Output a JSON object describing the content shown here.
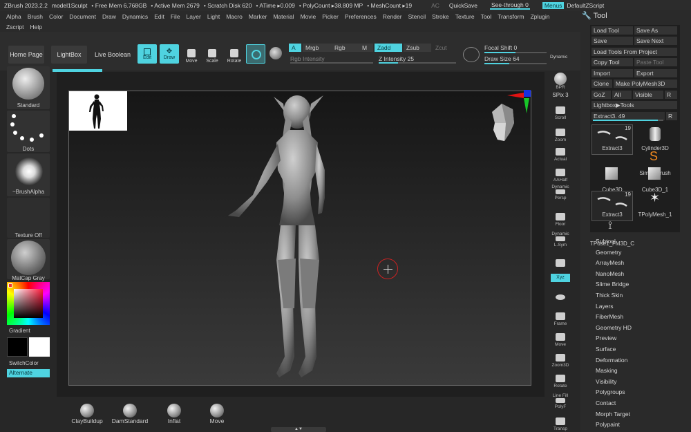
{
  "titlebar": {
    "app": "ZBrush 2023.2.2",
    "doc": "model1Sculpt",
    "free_mem": "• Free Mem 6.768GB",
    "active_mem": "• Active Mem 2679",
    "scratch": "• Scratch Disk 620",
    "atime": "• ATime ▸0.009",
    "polycount": "• PolyCount ▸38.809 MP",
    "meshcount": "• MeshCount ▸19",
    "ac": "AC",
    "quicksave": "QuickSave",
    "seethrough": "See-through",
    "seethrough_value": "0",
    "menus": "Menus",
    "script": "DefaultZScript"
  },
  "menu": {
    "row1": [
      "Alpha",
      "Brush",
      "Color",
      "Document",
      "Draw",
      "Dynamics",
      "Edit",
      "File",
      "Layer",
      "Light",
      "Macro",
      "Marker",
      "Material",
      "Movie",
      "Picker",
      "Preferences",
      "Render",
      "Stencil",
      "Stroke",
      "Texture",
      "Tool",
      "Transform",
      "Zplugin"
    ],
    "row2": [
      "Zscript",
      "Help"
    ]
  },
  "toolbar": {
    "home": "Home Page",
    "lightbox": "LightBox",
    "liveboolean": "Live Boolean",
    "edit": "Edit",
    "draw": "Draw",
    "move": "Move",
    "scale": "Scale",
    "rotate": "Rotate",
    "a": "A",
    "mrgb": "Mrgb",
    "rgb": "Rgb",
    "m": "M",
    "zadd": "Zadd",
    "zsub": "Zsub",
    "zcut": "Zcut",
    "rgb_intensity": "Rgb Intensity",
    "z_intensity": "Z Intensity",
    "z_intensity_value": "25",
    "focal_shift": "Focal Shift",
    "focal_value": "0",
    "draw_size": "Draw Size",
    "draw_size_value": "64",
    "dynamic": "Dynamic"
  },
  "left": {
    "brush": "Standard",
    "stroke": "Dots",
    "alpha": "~BrushAlpha",
    "texture": "Texture Off",
    "material": "MatCap Gray",
    "gradient": "Gradient",
    "switchcolor": "SwitchColor",
    "alternate": "Alternate"
  },
  "right_strip": {
    "bpr": "BPR",
    "spix": "SPix",
    "spix_value": "3",
    "scroll": "Scroll",
    "zoom": "Zoom",
    "actual": "Actual",
    "aahalf": "AAHalf",
    "dynamic": "Dynamic",
    "persp": "Persp",
    "floor": "Floor",
    "dynamic2": "Dynamic",
    "lsym": "L.Sym",
    "xyz": "Xyz",
    "frame": "Frame",
    "move": "Move",
    "zoom3d": "Zoom3D",
    "rotate": "Rotate",
    "linefill": "Line Fill",
    "polyf": "PolyF",
    "transp": "Transp"
  },
  "tool": {
    "title": "Tool",
    "buttons": {
      "load_tool": "Load Tool",
      "save_as": "Save As",
      "save": "Save",
      "save_next": "Save Next",
      "load_from_project": "Load Tools From Project",
      "copy_tool": "Copy Tool",
      "paste_tool": "Paste Tool",
      "import": "Import",
      "export": "Export",
      "clone": "Clone",
      "make_polymesh": "Make PolyMesh3D",
      "goz": "GoZ",
      "all": "All",
      "visible": "Visible",
      "r": "R",
      "lightbox_tools": "Lightbox▶Tools"
    },
    "extract_label": "Extract3.",
    "extract_value": "49",
    "r2": "R",
    "thumbs": [
      {
        "name": "Extract3",
        "count": "19"
      },
      {
        "name": "Cylinder3D",
        "count": ""
      },
      {
        "name": "SimpleBrush",
        "count": ""
      },
      {
        "name": "Cube3D",
        "count": ""
      },
      {
        "name": "Cube3D_1",
        "count": ""
      },
      {
        "name": "Extract3",
        "count": "19"
      },
      {
        "name": "TPolyMesh_1",
        "count": ""
      },
      {
        "name": "TPose1_FM3D_C",
        "count": ""
      }
    ],
    "subpalettes": [
      "Subtool",
      "Geometry",
      "ArrayMesh",
      "NanoMesh",
      "Slime Bridge",
      "Thick Skin",
      "Layers",
      "FiberMesh",
      "Geometry HD",
      "Preview",
      "Surface",
      "Deformation",
      "Masking",
      "Visibility",
      "Polygroups",
      "Contact",
      "Morph Target",
      "Polypaint"
    ]
  },
  "bottom": {
    "brushes": [
      "ClayBuildup",
      "DamStandard",
      "Inflat",
      "Move"
    ]
  },
  "colors": {
    "accent": "#4fd3e0",
    "panel": "#2a2a2a",
    "canvas_top": "#161616",
    "canvas_bottom": "#3a3a3a"
  },
  "progress": {
    "focal_shift_fraction": 0.5,
    "draw_size_fraction": 0.4,
    "z_intensity_fraction": 0.25,
    "extract_fraction": 0.92
  }
}
